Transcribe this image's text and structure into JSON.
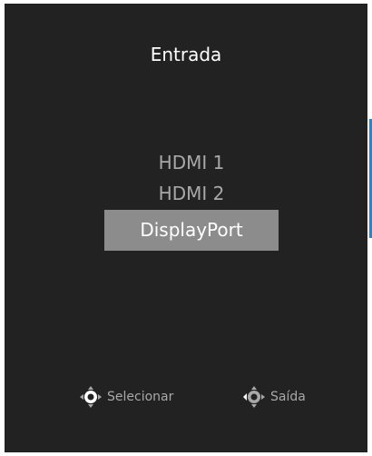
{
  "osd": {
    "title": "Entrada",
    "inputs": [
      {
        "label": "HDMI 1",
        "selected": false
      },
      {
        "label": "HDMI 2",
        "selected": false
      },
      {
        "label": "DisplayPort",
        "selected": true
      }
    ],
    "footer": {
      "select_label": "Selecionar",
      "select_icon": "joystick-press-icon",
      "exit_label": "Saída",
      "exit_icon": "joystick-left-icon"
    }
  },
  "colors": {
    "panel_bg": "#222222",
    "highlight_bg": "#8c8c8c",
    "accent": "#1e88d8",
    "text_dim": "#a8a8a8",
    "text_bright": "#ffffff"
  }
}
